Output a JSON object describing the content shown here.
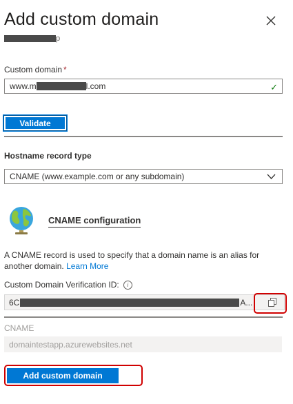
{
  "panel": {
    "title": "Add custom domain",
    "subtitle_suffix": "p"
  },
  "custom_domain": {
    "label": "Custom domain",
    "required_mark": "*",
    "value_prefix": "www.m",
    "value_suffix": "l.com"
  },
  "validate_button": {
    "label": "Validate"
  },
  "hostname_record": {
    "label": "Hostname record type",
    "selected": "CNAME (www.example.com or any subdomain)"
  },
  "cname_config": {
    "title": "CNAME configuration",
    "description": "A CNAME record is used to specify that a domain name is an alias for another domain.",
    "learn_more": "Learn More"
  },
  "verification": {
    "label": "Custom Domain Verification ID:",
    "value_prefix": "6C",
    "value_suffix": "A..."
  },
  "cname": {
    "label": "CNAME",
    "value": "domaintestapp.azurewebsites.net"
  },
  "add_button": {
    "label": "Add custom domain"
  },
  "colors": {
    "accent": "#0078d4",
    "highlight": "#d00000",
    "success": "#107c10"
  },
  "icons": [
    "close-icon",
    "checkmark-icon",
    "chevron-down-icon",
    "globe-icon",
    "info-icon",
    "copy-icon"
  ]
}
